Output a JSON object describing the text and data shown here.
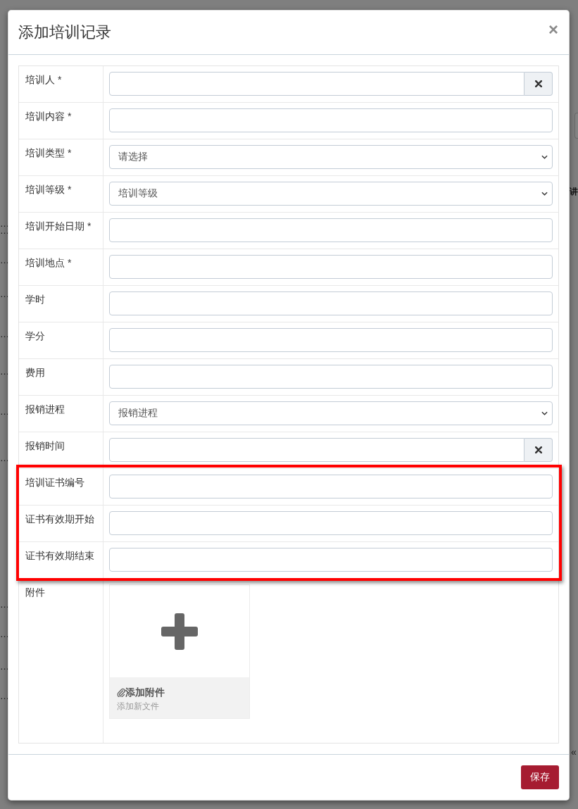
{
  "backdrop": {
    "left_cells": [
      "…",
      "…",
      "…",
      "…",
      "…",
      "…",
      "…",
      "…",
      "…",
      "…",
      "…",
      "…"
    ],
    "right_fragment": "讲",
    "pager_toggle": "«"
  },
  "modal": {
    "title": "添加培训记录",
    "close": "×"
  },
  "form": {
    "rows": [
      {
        "label": "培训人 *",
        "kind": "clearable",
        "highlighted": false
      },
      {
        "label": "培训内容 *",
        "kind": "text",
        "highlighted": false
      },
      {
        "label": "培训类型 *",
        "kind": "select",
        "value": "请选择",
        "highlighted": false
      },
      {
        "label": "培训等级 *",
        "kind": "select",
        "value": "培训等级",
        "highlighted": false
      },
      {
        "label": "培训开始日期 *",
        "kind": "text",
        "highlighted": false
      },
      {
        "label": "培训地点 *",
        "kind": "text",
        "highlighted": false
      },
      {
        "label": "学时",
        "kind": "text",
        "highlighted": false
      },
      {
        "label": "学分",
        "kind": "text",
        "highlighted": false
      },
      {
        "label": "费用",
        "kind": "text",
        "highlighted": false
      },
      {
        "label": "报销进程",
        "kind": "select",
        "value": "报销进程",
        "highlighted": false
      },
      {
        "label": "报销时间",
        "kind": "clearable",
        "highlighted": false
      },
      {
        "label": "培训证书编号",
        "kind": "text",
        "highlighted": true
      },
      {
        "label": "证书有效期开始",
        "kind": "text",
        "highlighted": true
      },
      {
        "label": "证书有效期结束",
        "kind": "text",
        "highlighted": true
      }
    ],
    "attachment": {
      "label": "附件",
      "title": "添加附件",
      "hint": "添加新文件"
    }
  },
  "footer": {
    "buttons": [
      {
        "label": "保存",
        "kind": "primary"
      }
    ]
  }
}
